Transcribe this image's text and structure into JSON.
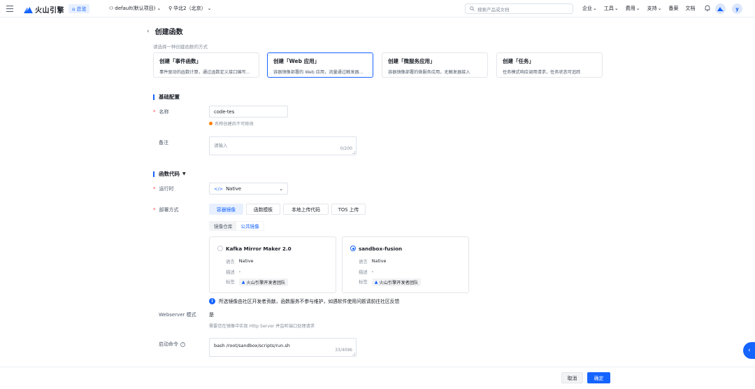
{
  "topbar": {
    "logo_text": "火山引擎",
    "overview": "总览",
    "project": "default(默认项目)",
    "region": "华北2（北京）",
    "search_placeholder": "搜索产品或文档",
    "nav": [
      "企业",
      "工具",
      "费用",
      "支持",
      "备案",
      "文档"
    ],
    "user_initial": "y"
  },
  "page": {
    "title": "创建函数",
    "choose_hint": "请选择一种创建函数的方式"
  },
  "cards": [
    {
      "title": "创建「事件函数」",
      "desc": "事件驱动的函数计算，通过函数定义接口编写..."
    },
    {
      "title": "创建「Web 应用」",
      "desc": "容器镜像部署的 Web 应用，流量通过触发器..."
    },
    {
      "title": "创建「微服务应用」",
      "desc": "容器镜像部署的微服务应用，无触发器接入"
    },
    {
      "title": "创建「任务」",
      "desc": "任务模式响应调用请求，任务状态可追踪"
    }
  ],
  "basic": {
    "section": "基础配置",
    "name_label": "名称",
    "name_value": "code-tes",
    "name_hint": "名称创建后不可修改",
    "remark_label": "备注",
    "remark_placeholder": "请输入",
    "remark_counter": "0/200"
  },
  "code": {
    "section": "函数代码",
    "runtime_label": "运行时",
    "runtime_value": "Native",
    "deploy_label": "部署方式",
    "deploy_tabs": [
      "容器镜像",
      "函数模板",
      "本地上传代码",
      "TOS 上传"
    ],
    "source_tabs": [
      "镜像仓库",
      "公共镜像"
    ],
    "images": [
      {
        "name": "Kafka Mirror Maker 2.0",
        "lang_k": "语言",
        "lang_v": "Native",
        "desc_k": "描述",
        "desc_v": "-",
        "tag_k": "标签",
        "tag_v": "火山引擎开发者团队"
      },
      {
        "name": "sandbox-fusion",
        "lang_k": "语言",
        "lang_v": "Native",
        "desc_k": "描述",
        "desc_v": "-",
        "tag_k": "标签",
        "tag_v": "火山引擎开发者团队"
      }
    ],
    "notice": "所选镜像由社区开发者贡献，函数服务不参与维护，如遇软件使用问题请前往社区反馈",
    "webserver_label": "Webserver 模式",
    "webserver_value": "是",
    "webserver_hint": "需要您在镜像中实现 Http Server 并监听端口处理请求",
    "cmd_label": "启动命令",
    "cmd_value": "bash /root/sandbox/scripts/run.sh",
    "cmd_counter": "33/4096"
  },
  "footer": {
    "cancel": "取消",
    "ok": "确定"
  },
  "colors": {
    "accent": "#1664ff",
    "required": "#f53f3f",
    "warn": "#ff7d00"
  }
}
